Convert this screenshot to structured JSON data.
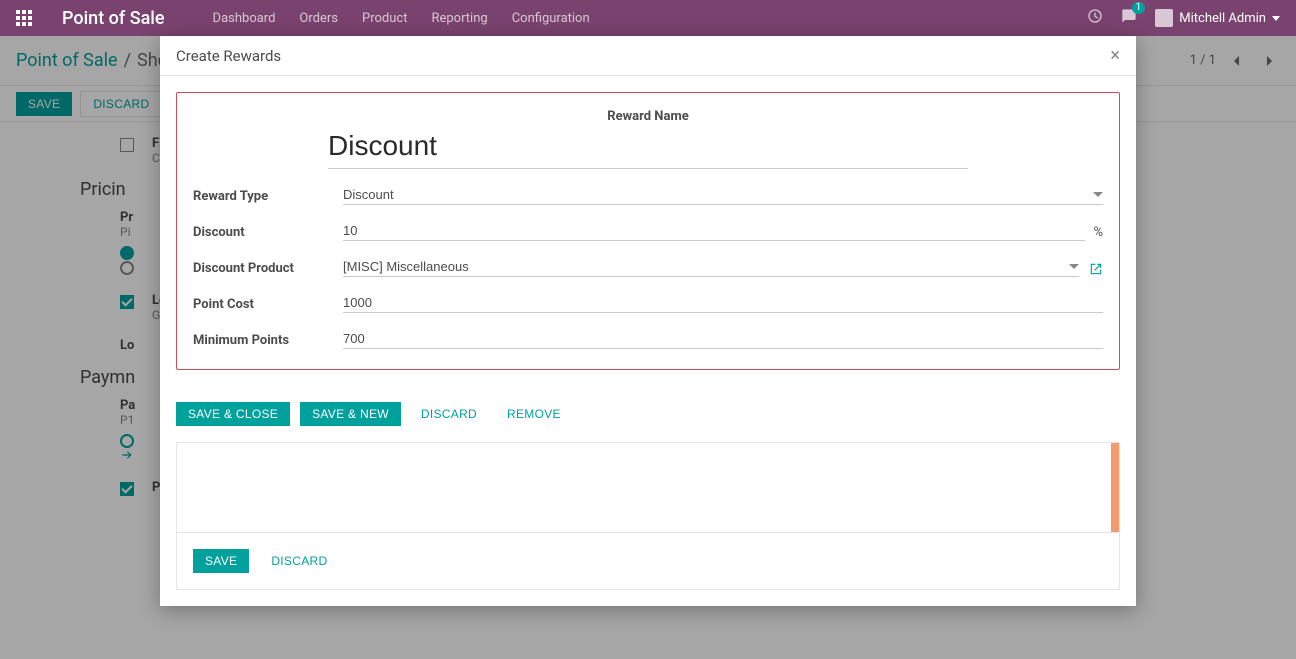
{
  "nav": {
    "title": "Point of Sale",
    "links": [
      "Dashboard",
      "Orders",
      "Product",
      "Reporting",
      "Configuration"
    ],
    "chat_count": "1",
    "user": "Mitchell Admin"
  },
  "breadcrumb": {
    "root": "Point of Sale",
    "sep": "/",
    "current": "Sho",
    "pager": "1 / 1"
  },
  "action_bar": {
    "save": "Save",
    "discard": "Discard"
  },
  "bg": {
    "fi_label_cut": "Fi",
    "c_cut": "C",
    "pricing_title": "Pricin",
    "pr_label_cut": "Pr",
    "pi_cut": "Pi",
    "lo_cut": "Lo",
    "g_cut": "G",
    "lo2_cut": "Lo",
    "payment_title": "Paymn",
    "pa_cut": "Pa",
    "p_cut": "P1",
    "prefill": "Prefill Cash Payment"
  },
  "modal": {
    "title": "Create Rewards",
    "close": "×",
    "labels": {
      "reward_name": "Reward Name",
      "reward_type": "Reward Type",
      "discount": "Discount",
      "discount_product": "Discount Product",
      "point_cost": "Point Cost",
      "minimum_points": "Minimum Points"
    },
    "values": {
      "reward_name": "Discount",
      "reward_type": "Discount",
      "discount": "10",
      "discount_unit": "%",
      "discount_product": "[MISC] Miscellaneous",
      "point_cost": "1000",
      "minimum_points": "700"
    },
    "actions": {
      "save_close": "Save & Close",
      "save_new": "Save & New",
      "discard": "Discard",
      "remove": "Remove"
    },
    "lower": {
      "save": "Save",
      "discard": "Discard"
    }
  }
}
